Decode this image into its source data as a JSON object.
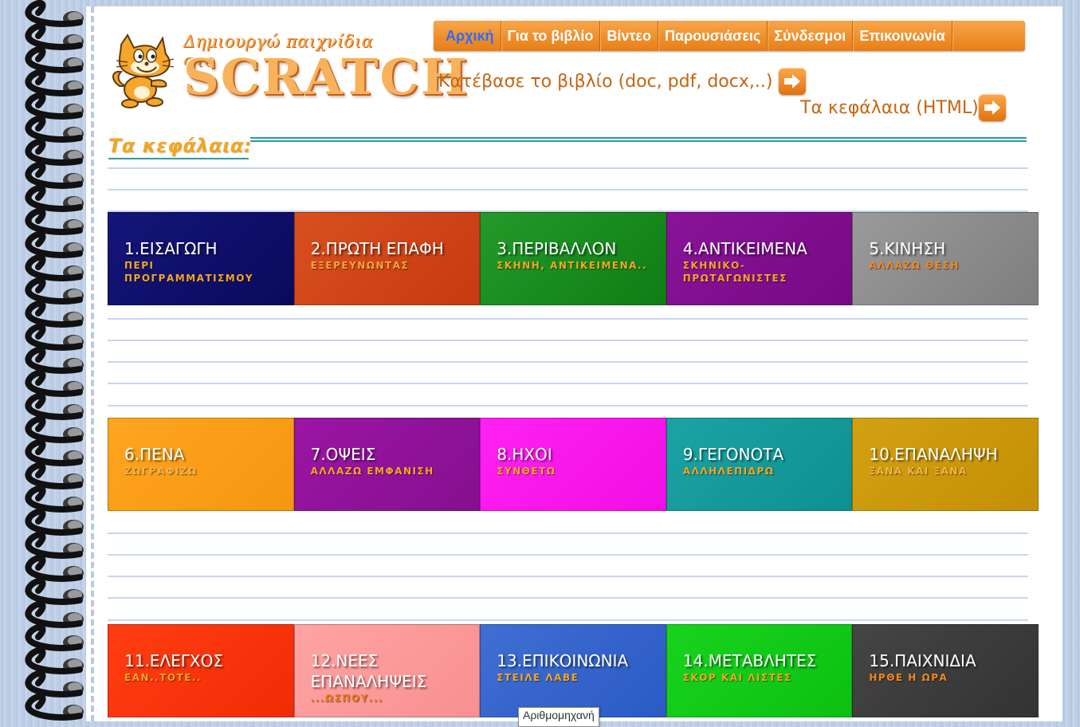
{
  "nav": {
    "items": [
      {
        "label": "Αρχική",
        "active": true
      },
      {
        "label": "Για το βιβλίο"
      },
      {
        "label": "Βίντεο"
      },
      {
        "label": "Παρουσιάσεις"
      },
      {
        "label": "Σύνδεσμοι"
      },
      {
        "label": "Επικοινωνία"
      }
    ]
  },
  "logo": {
    "script_text": "Δημιουργώ παιχνίδια στο",
    "word": "SCRATCH"
  },
  "links": {
    "download": "Κατέβασε το βιβλίο (doc, pdf, docx,..)",
    "chapters_html": "Τα κεφάλαια (HTML)"
  },
  "heading": "Τα κεφάλαια:",
  "rows": [
    [
      {
        "title": "1.ΕΙΣΑΓΩΓΗ",
        "sub": "ΠΕΡΙ ΠΡΟΓΡΑΜΜΑΤΙΣΜΟΥ",
        "color": "#15157a",
        "color2": "#0a0a5c",
        "subcolor": "#f5a623"
      },
      {
        "title": "2.ΠΡΩΤΗ ΕΠΑΦΗ",
        "sub": "ΕΞΕΡΕΥΝΩΝΤΑΣ",
        "color": "#d8501f",
        "color2": "#c63a10",
        "subcolor": "#f8a53a"
      },
      {
        "title": "3.ΠΕΡΙΒΑΛΛΟΝ",
        "sub": "ΣΚΗΝΗ, ΑΝΤΙΚΕΙΜΕΝΑ..",
        "color": "#239a2a",
        "color2": "#0f7d14",
        "subcolor": "#f5a623"
      },
      {
        "title": "4.ΑΝΤΙΚΕΙΜΕΝΑ",
        "sub": "ΣΚΗΝΙΚΟ-ΠΡΩΤΑΓΩΝΙΣΤΕΣ",
        "color": "#8a1399",
        "color2": "#760a83",
        "subcolor": "#f5a623"
      },
      {
        "title": "5.ΚΙΝΗΣΗ",
        "sub": "ΑΛΛΑΖΩ ΘΕΣΗ",
        "color": "#9a9a9a",
        "color2": "#7e7e7e",
        "subcolor": "#f08a1e"
      }
    ],
    [
      {
        "title": "6.ΠΕΝΑ",
        "sub": "ΖΩΓΡΑΦΙΖΩ",
        "color": "#ffa51f",
        "color2": "#f59610",
        "subcolor": "#f4b24d"
      },
      {
        "title": "7.ΟΨΕΙΣ",
        "sub": "ΑΛΛΑΖΩ ΕΜΦΑΝΙΣΗ",
        "color": "#9b15a5",
        "color2": "#85108f",
        "subcolor": "#f5a623"
      },
      {
        "title": "8.ΗΧΟΙ",
        "sub": "ΣΥΝΘΕΤΩ",
        "color": "#ff21f2",
        "color2": "#f20ee6",
        "subcolor": "#f5a623"
      },
      {
        "title": "9.ΓΕΓΟΝΟΤΑ",
        "sub": "ΑΛΛΗΛΕΠΙΔΡΩ",
        "color": "#1ba3a3",
        "color2": "#0e9090",
        "subcolor": "#f5a623"
      },
      {
        "title": "10.ΕΠΑΝΑΛΗΨΗ",
        "sub": "ΞΑΝΑ ΚΑΙ ΞΑΝΑ",
        "color": "#d2a112",
        "color2": "#c48f05",
        "subcolor": "#f3b649"
      }
    ],
    [
      {
        "title": "11.ΕΛΕΓΧΟΣ",
        "sub": "ΕΑΝ..ΤΟΤΕ..",
        "color": "#ff3d12",
        "color2": "#f02c05",
        "subcolor": "#f5a623"
      },
      {
        "title": "12.ΝΕΕΣ ΕΠΑΝΑΛΗΨΕΙΣ",
        "sub": "...ΩΣΠΟΥ...",
        "color": "#ffa3a3",
        "color2": "#f89090",
        "subcolor": "#e77f10"
      },
      {
        "title": "13.ΕΠΙΚΟΙΝΩΝΙΑ",
        "sub": "ΣΤΕΙΛΕ ΛΑΒΕ",
        "color": "#3f6fd3",
        "color2": "#2a5ac4",
        "subcolor": "#f5a623"
      },
      {
        "title": "14.ΜΕΤΑΒΛΗΤΕΣ",
        "sub": "ΣΚΟΡ ΚΑΙ ΛΙΣΤΕΣ",
        "color": "#18d31d",
        "color2": "#0cc012",
        "subcolor": "#f5a623"
      },
      {
        "title": "15.ΠΑΙΧΝΙΔΙΑ",
        "sub": "ΗΡΘΕ Η ΩΡΑ",
        "color": "#454545",
        "color2": "#333333",
        "subcolor": "#f08a1e"
      }
    ]
  ],
  "tooltip": "Αριθμομηχανή"
}
